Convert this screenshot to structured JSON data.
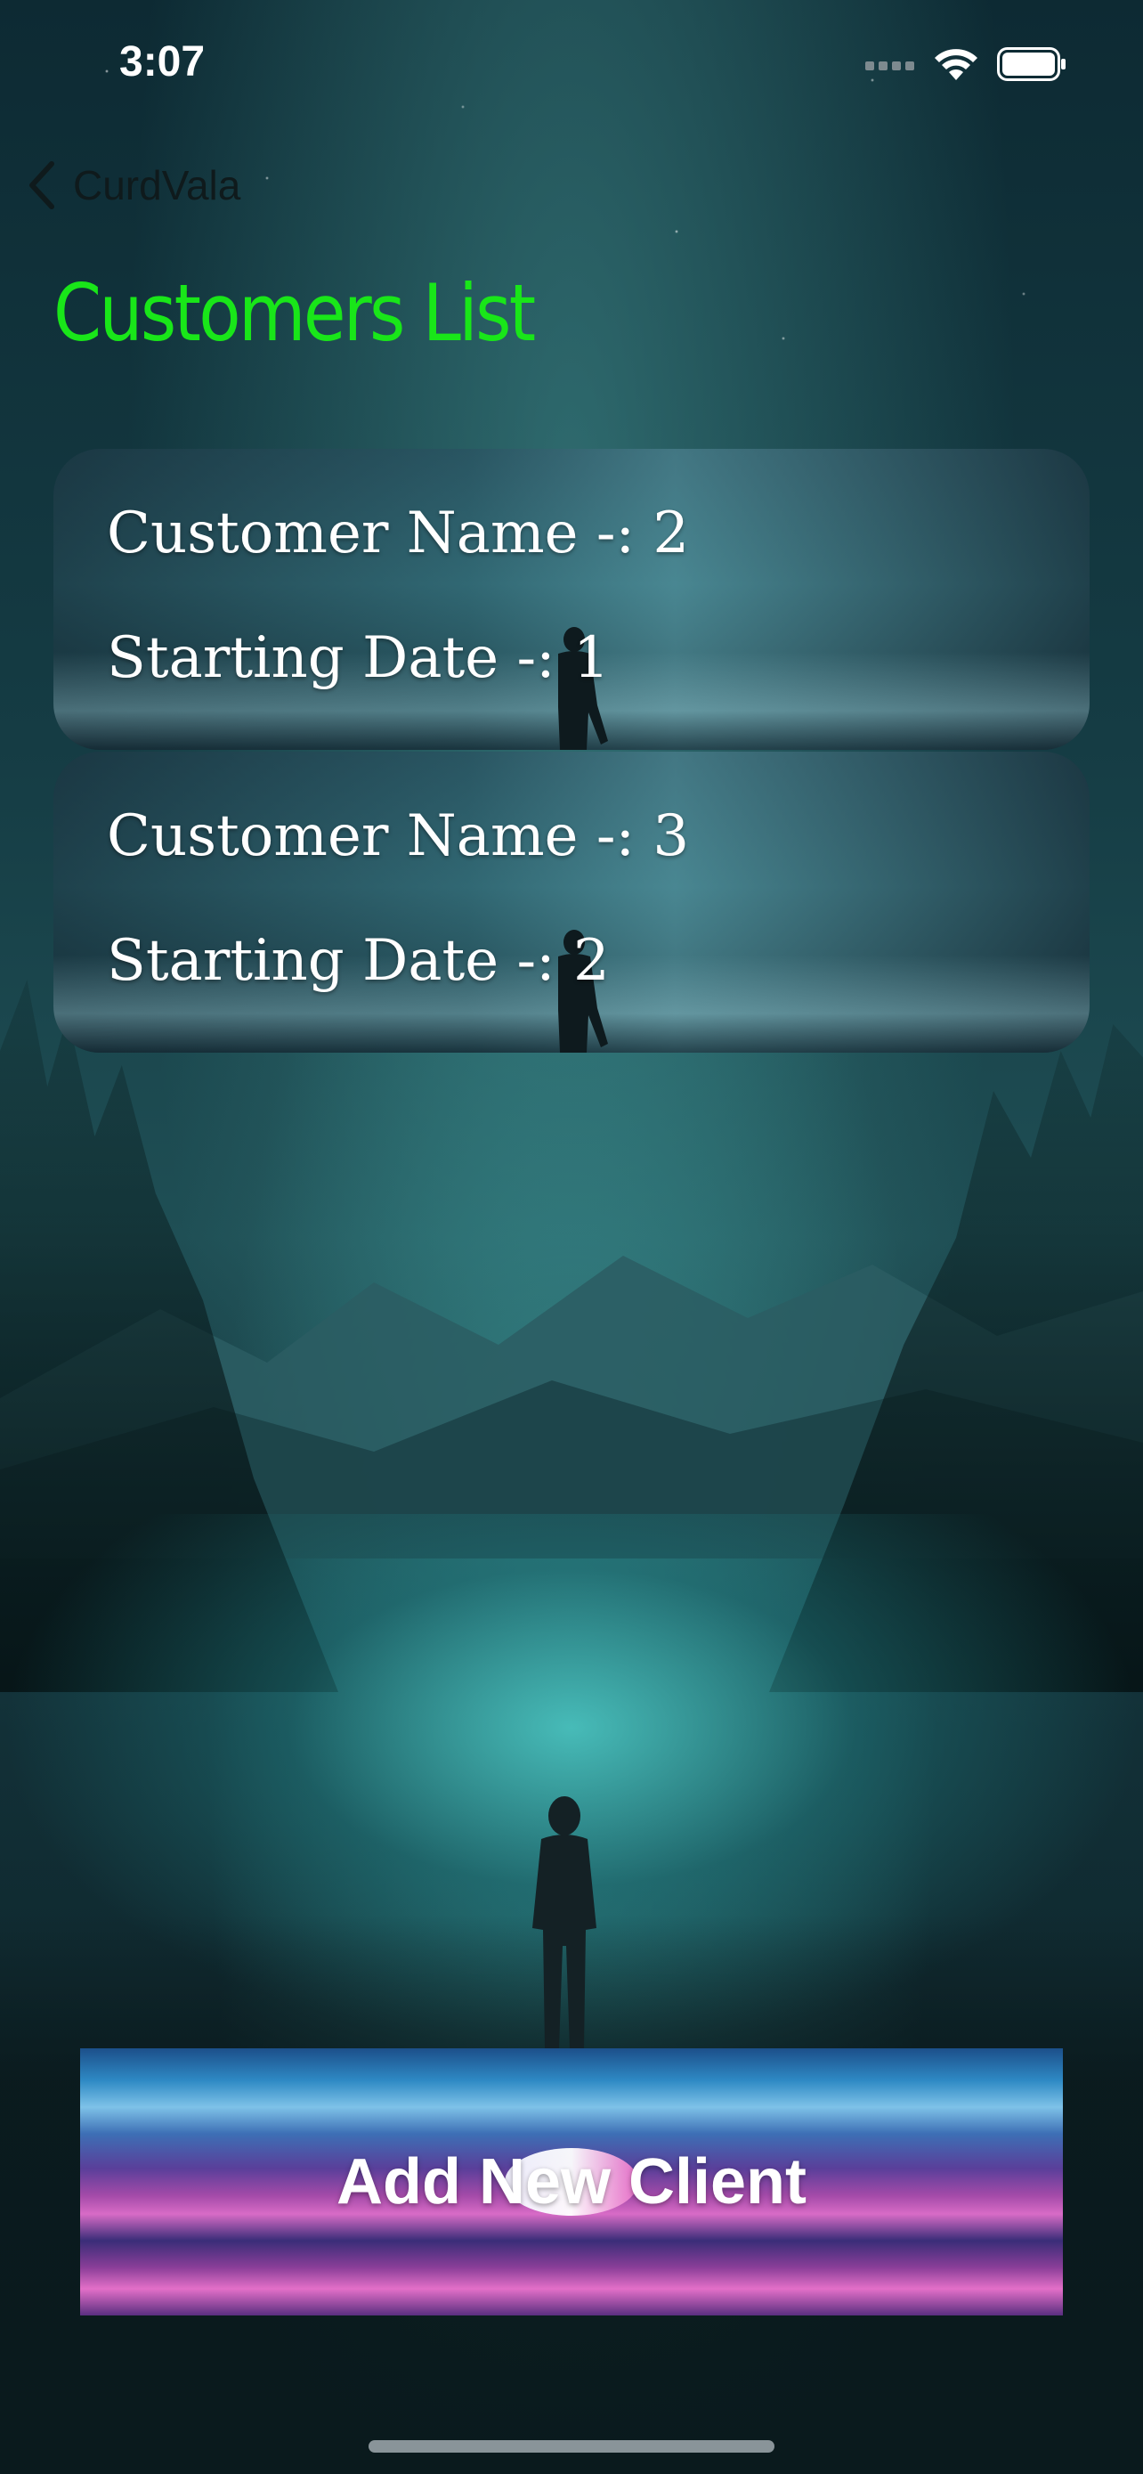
{
  "status_bar": {
    "time": "3:07",
    "icons": [
      "cellular-signal-icon",
      "wifi-icon",
      "battery-icon"
    ]
  },
  "nav": {
    "back_label": "CurdVala",
    "back_icon": "chevron-left-icon"
  },
  "page": {
    "title": "Customers List",
    "title_color": "#19e619"
  },
  "customers": [
    {
      "name_text": "Customer Name -: 2",
      "date_text": "Starting Date -: 1"
    },
    {
      "name_text": "Customer Name -: 3",
      "date_text": "Starting Date -: 2"
    }
  ],
  "actions": {
    "add_client_label": "Add New Client"
  }
}
